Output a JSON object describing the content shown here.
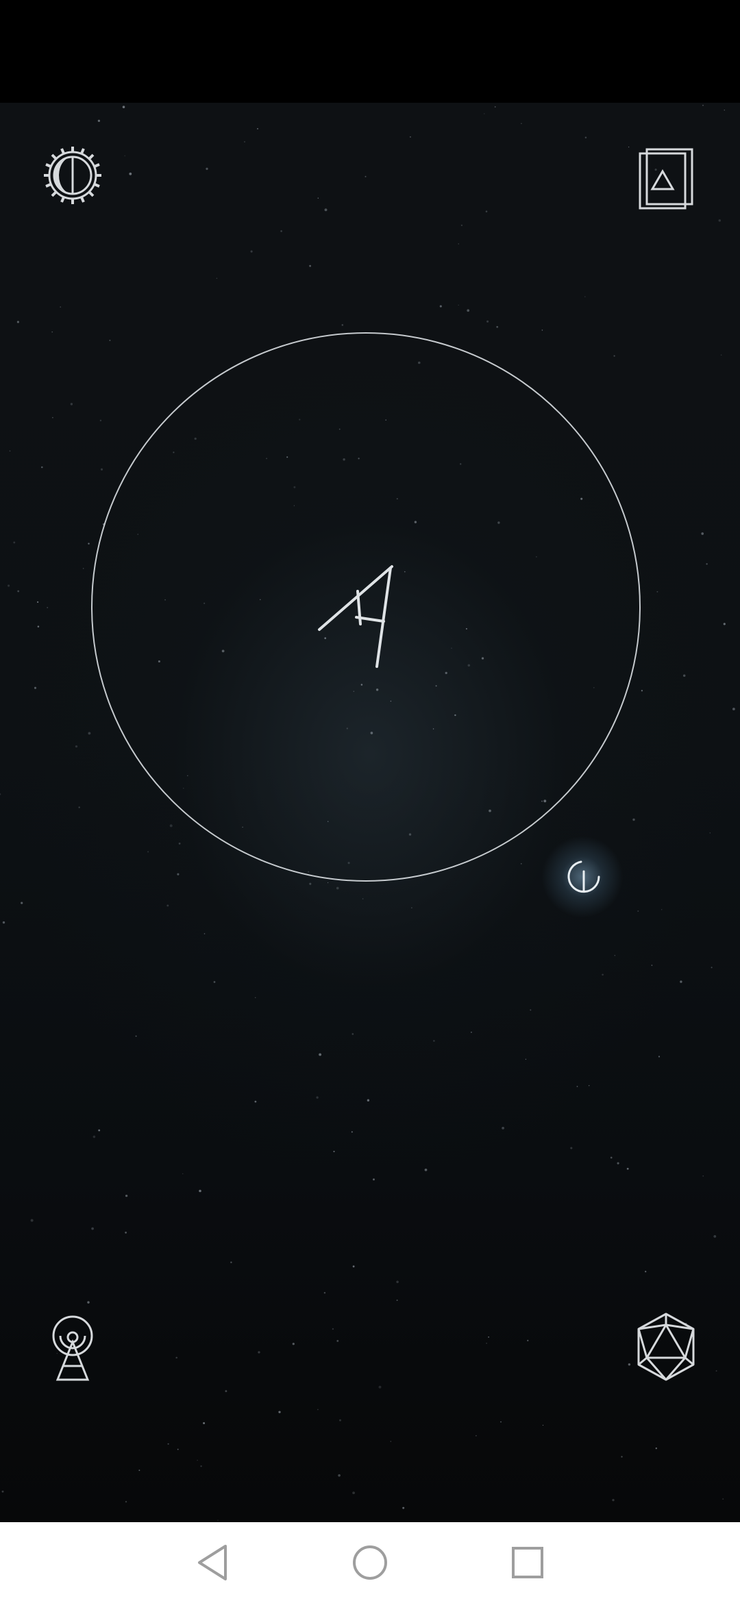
{
  "screen": {
    "title": "",
    "status_bar_color": "#000000",
    "background_color": "#0d1114",
    "accent_color": "#e6ebee"
  },
  "top_controls": {
    "settings": {
      "icon": "gear-moon-icon"
    },
    "cards": {
      "icon": "triangle-cards-icon"
    }
  },
  "rune_circle": {
    "glyph_icon": "rune-glyph-icon",
    "stroke_color": "#e6ebee"
  },
  "glow_orb": {
    "icon": "crescent-rune-icon",
    "glow_color": "#82aac8"
  },
  "bottom_controls": {
    "broadcast": {
      "icon": "antenna-tower-icon"
    },
    "polyhedron": {
      "icon": "icosahedron-icon"
    }
  },
  "nav_bar": {
    "back_icon": "back-triangle-icon",
    "home_icon": "home-circle-icon",
    "recents_icon": "recents-square-icon",
    "icon_color": "#9e9e9e",
    "background_color": "#ffffff"
  }
}
